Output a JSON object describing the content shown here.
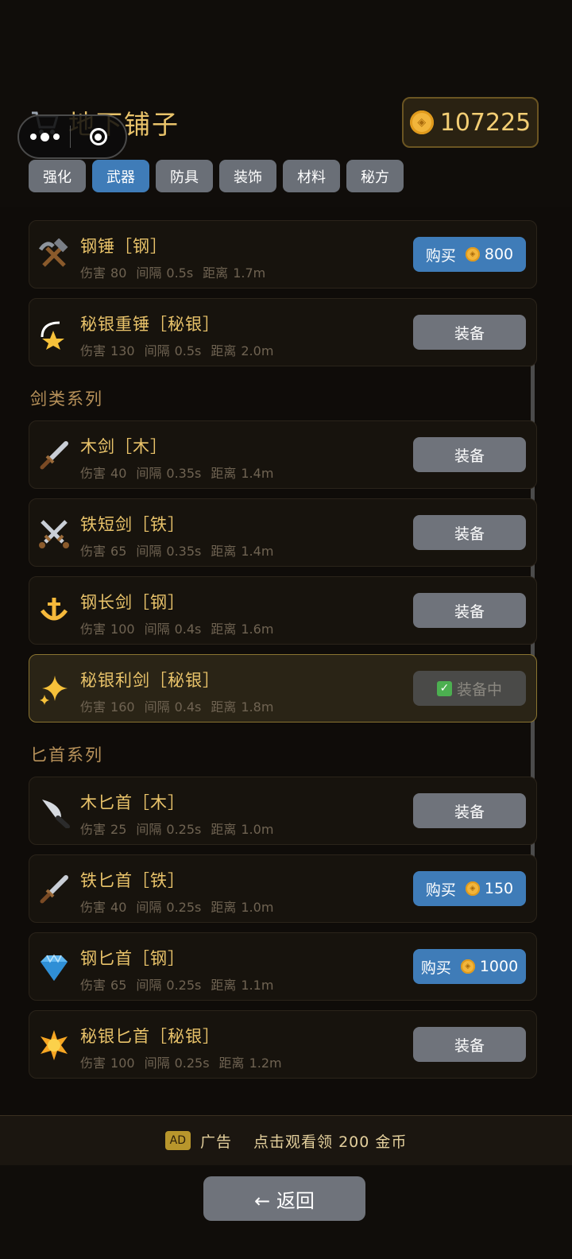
{
  "header": {
    "title": "地下铺子",
    "coins": "107225",
    "tabs": [
      "强化",
      "武器",
      "防具",
      "装饰",
      "材料",
      "秘方"
    ],
    "active_tab": "武器"
  },
  "stat_labels": {
    "damage": "伤害",
    "interval": "间隔",
    "range": "距离"
  },
  "sections": {
    "swords": "剑类系列",
    "daggers": "匕首系列"
  },
  "items": [
    {
      "name": "钢锤［钢］",
      "damage": "80",
      "interval": "0.5s",
      "range": "1.7m",
      "action": "buy",
      "label": "购买",
      "price": "800",
      "icon": "hammer-pick-icon"
    },
    {
      "name": "秘银重锤［秘银］",
      "damage": "130",
      "interval": "0.5s",
      "range": "2.0m",
      "action": "equip",
      "label": "装备",
      "icon": "shooting-star-icon"
    },
    {
      "name": "木剑［木］",
      "damage": "40",
      "interval": "0.35s",
      "range": "1.4m",
      "action": "equip",
      "label": "装备",
      "icon": "dagger-icon"
    },
    {
      "name": "铁短剑［铁］",
      "damage": "65",
      "interval": "0.35s",
      "range": "1.4m",
      "action": "equip",
      "label": "装备",
      "icon": "crossed-swords-icon"
    },
    {
      "name": "钢长剑［钢］",
      "damage": "100",
      "interval": "0.4s",
      "range": "1.6m",
      "action": "equip",
      "label": "装备",
      "icon": "trident-icon"
    },
    {
      "name": "秘银利剑［秘银］",
      "damage": "160",
      "interval": "0.4s",
      "range": "1.8m",
      "action": "equipped",
      "label": "装备中",
      "icon": "sparkles-icon"
    },
    {
      "name": "木匕首［木］",
      "damage": "25",
      "interval": "0.25s",
      "range": "1.0m",
      "action": "equip",
      "label": "装备",
      "icon": "kitchen-knife-icon"
    },
    {
      "name": "铁匕首［铁］",
      "damage": "40",
      "interval": "0.25s",
      "range": "1.0m",
      "action": "buy",
      "label": "购买",
      "price": "150",
      "icon": "dagger-icon"
    },
    {
      "name": "钢匕首［钢］",
      "damage": "65",
      "interval": "0.25s",
      "range": "1.1m",
      "action": "buy",
      "label": "购买",
      "price": "1000",
      "icon": "gem-icon"
    },
    {
      "name": "秘银匕首［秘银］",
      "damage": "100",
      "interval": "0.25s",
      "range": "1.2m",
      "action": "equip",
      "label": "装备",
      "icon": "star-burst-icon"
    }
  ],
  "ad": {
    "tag": "AD",
    "text": "广告　 点击观看领 200 金币"
  },
  "back_label": "← 返回"
}
